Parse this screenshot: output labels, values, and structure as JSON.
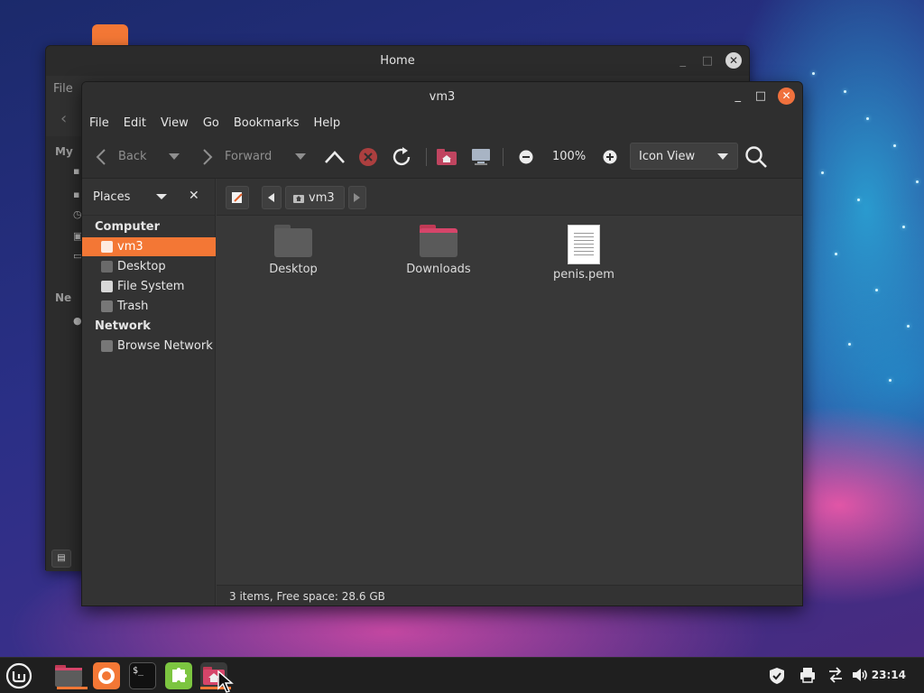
{
  "back_window": {
    "title": "Home",
    "menu_file": "File",
    "stub_labels": [
      "My",
      "Ne"
    ]
  },
  "window": {
    "title": "vm3",
    "menu": [
      "File",
      "Edit",
      "View",
      "Go",
      "Bookmarks",
      "Help"
    ],
    "toolbar": {
      "back_label": "Back",
      "forward_label": "Forward",
      "zoom_level": "100%",
      "view_mode": "Icon View"
    },
    "sidebar": {
      "header": "Places",
      "sections": [
        {
          "title": "Computer",
          "items": [
            "vm3",
            "Desktop",
            "File System",
            "Trash"
          ]
        },
        {
          "title": "Network",
          "items": [
            "Browse Network"
          ]
        }
      ],
      "selected": "vm3"
    },
    "pathbar": {
      "current": "vm3"
    },
    "files": [
      {
        "name": "Desktop",
        "type": "folder"
      },
      {
        "name": "Downloads",
        "type": "folder"
      },
      {
        "name": "penis.pem",
        "type": "document"
      }
    ],
    "status": "3 items, Free space: 28.6 GB"
  },
  "taskbar": {
    "clock": "23:14",
    "apps": [
      "menu",
      "files",
      "firefox",
      "terminal",
      "extensions",
      "home-folder"
    ]
  },
  "colors": {
    "accent": "#f37735",
    "folder": "#e74f6b",
    "panel": "#1f1f1f"
  }
}
